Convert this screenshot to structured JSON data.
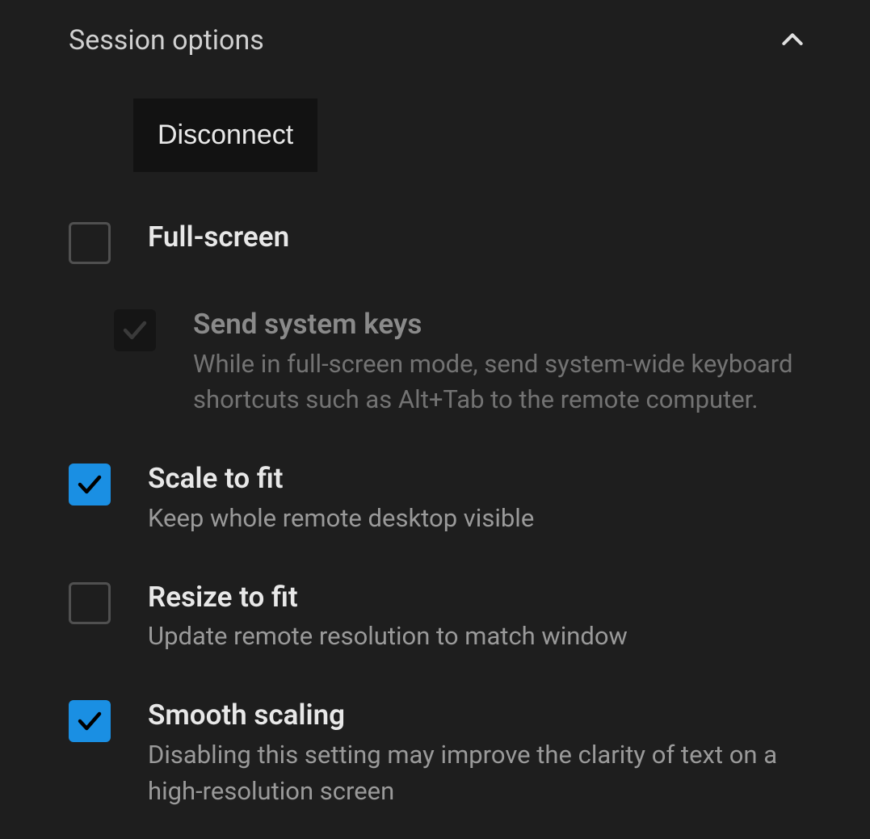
{
  "header": {
    "title": "Session options"
  },
  "disconnect_label": "Disconnect",
  "options": {
    "full_screen": {
      "label": "Full-screen",
      "checked": false
    },
    "send_system_keys": {
      "label": "Send system keys",
      "desc": "While in full-screen mode, send system-wide keyboard shortcuts such as Alt+Tab to the remote computer.",
      "checked": true,
      "disabled": true
    },
    "scale_to_fit": {
      "label": "Scale to fit",
      "desc": "Keep whole remote desktop visible",
      "checked": true
    },
    "resize_to_fit": {
      "label": "Resize to fit",
      "desc": "Update remote resolution to match window",
      "checked": false
    },
    "smooth_scaling": {
      "label": "Smooth scaling",
      "desc": "Disabling this setting may improve the clarity of text on a high-resolution screen",
      "checked": true
    }
  }
}
